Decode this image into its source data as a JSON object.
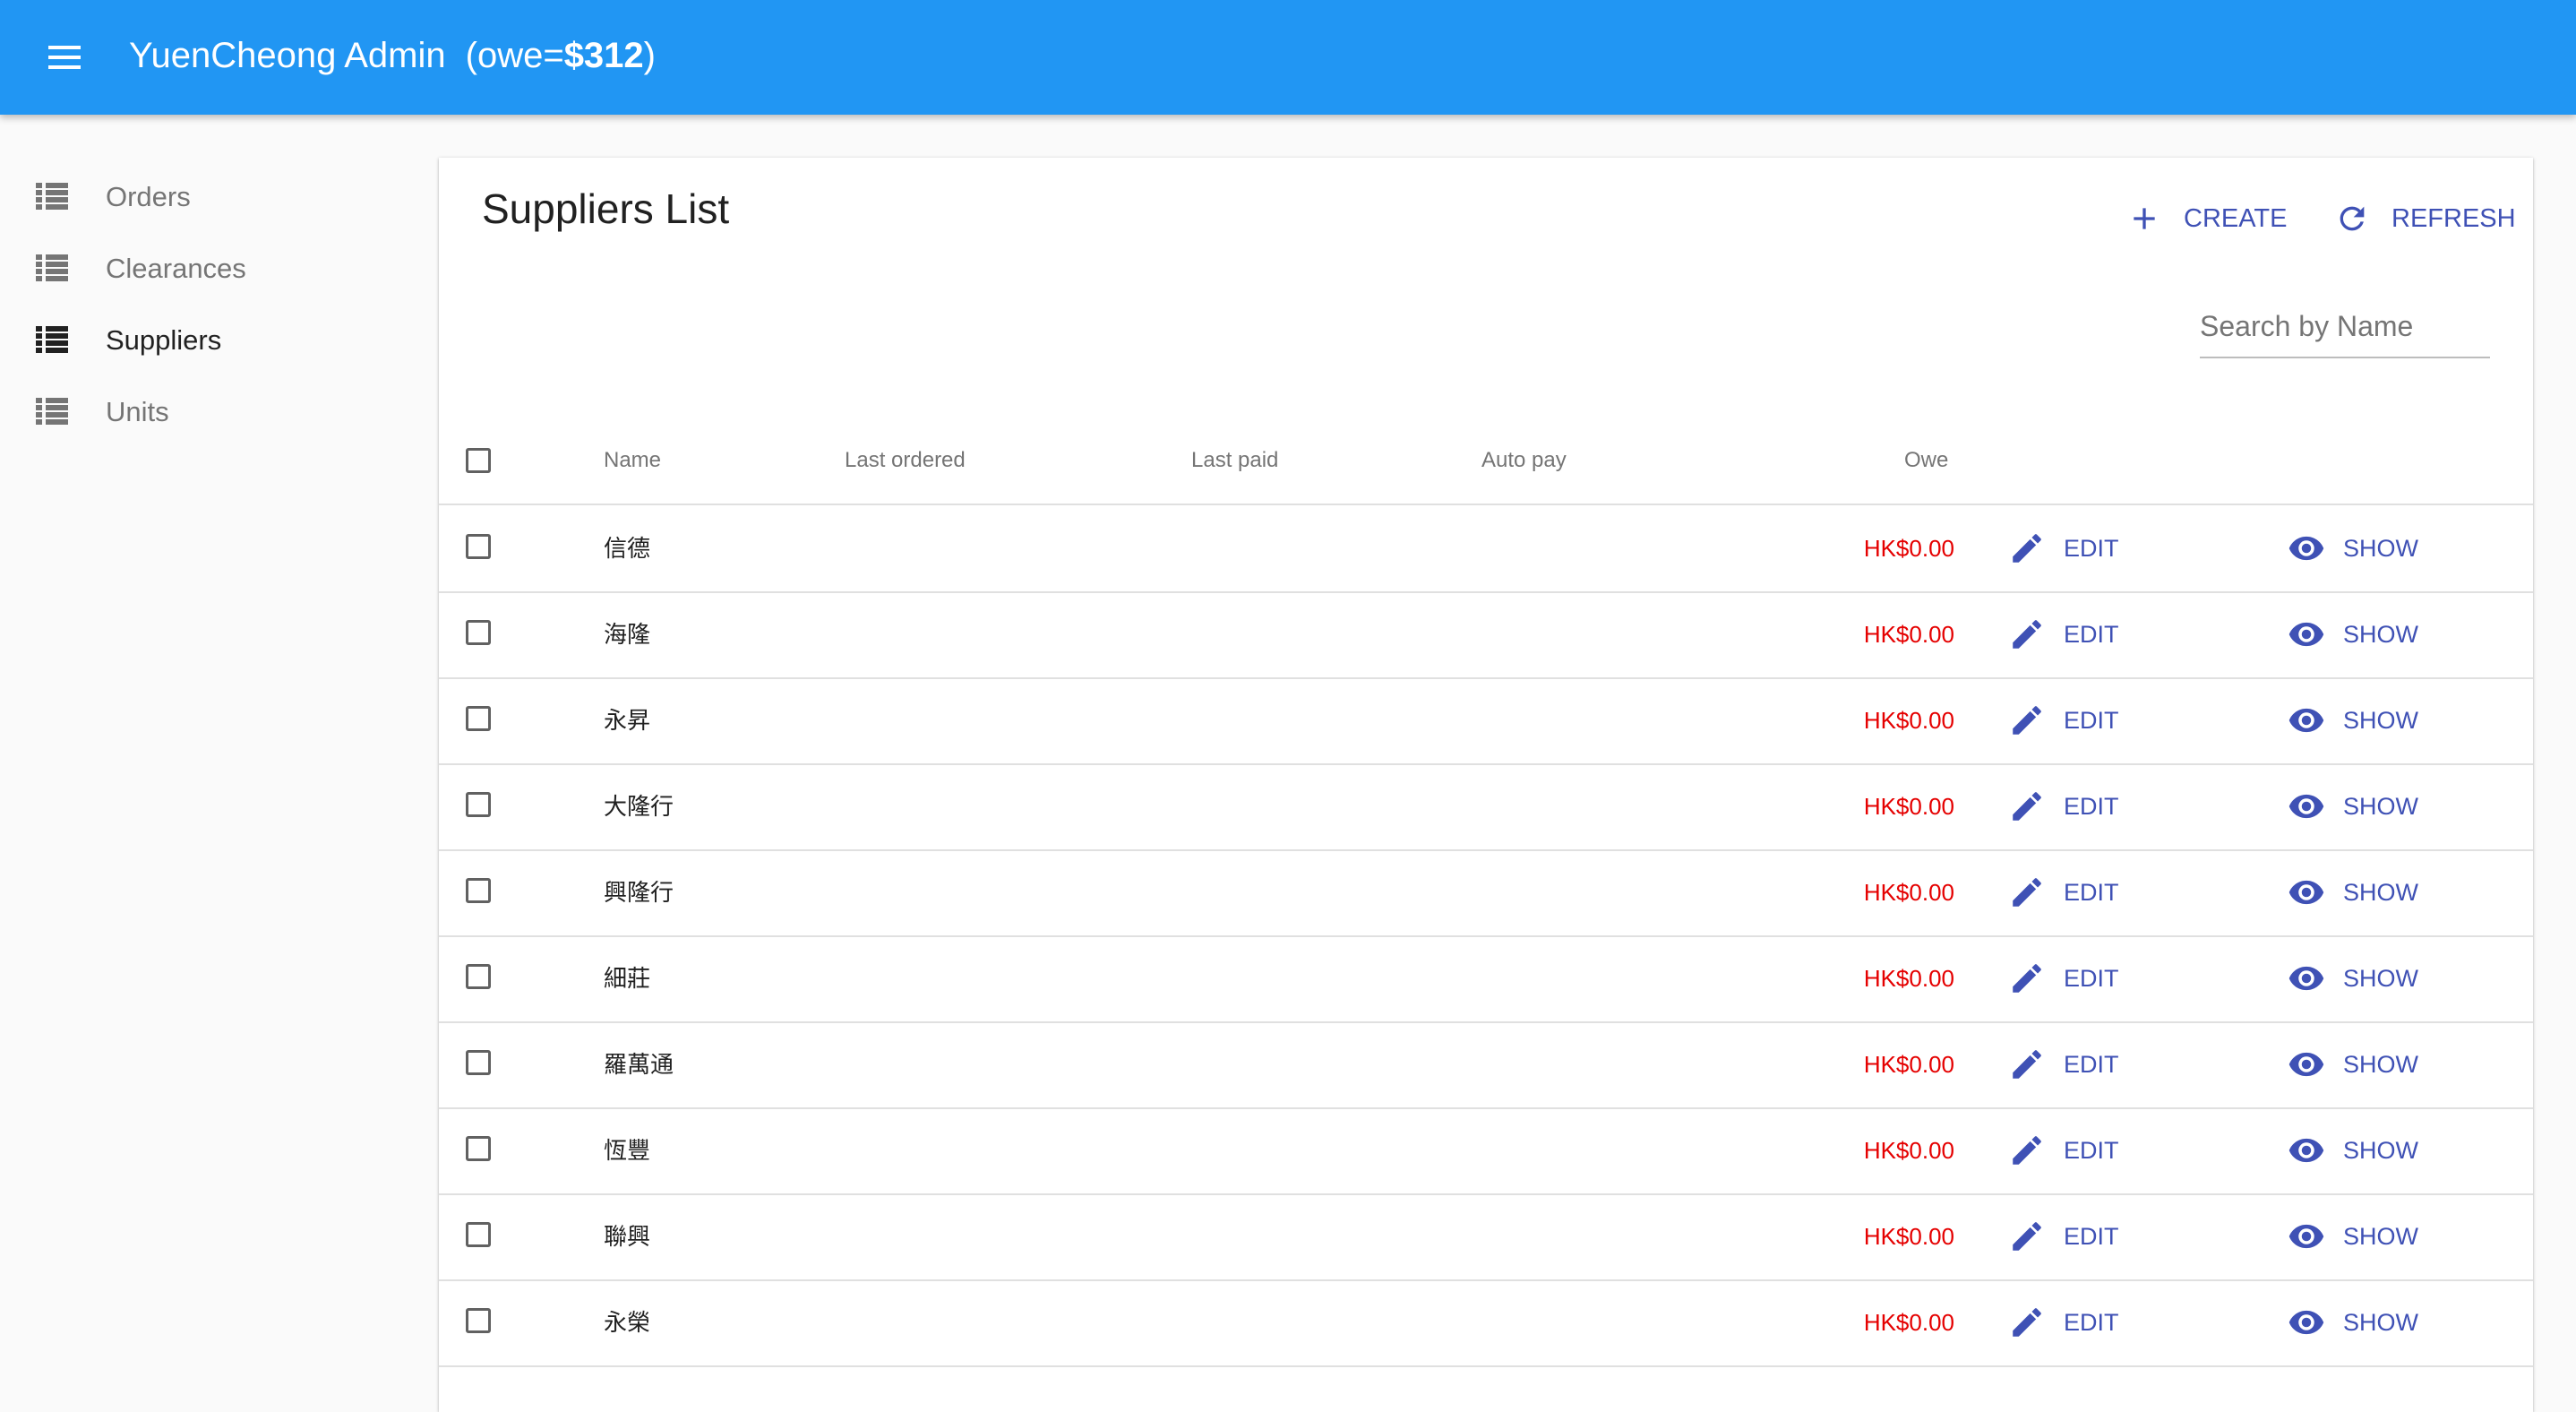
{
  "app": {
    "title": "YuenCheong Admin",
    "owe_prefix": "(owe=",
    "owe_amount": "$312",
    "owe_suffix": ")",
    "menu_icon": "hamburger-menu-icon",
    "bar_color": "#2196f3"
  },
  "sidebar": {
    "items": [
      {
        "label": "Orders",
        "icon": "list-icon",
        "active": false
      },
      {
        "label": "Clearances",
        "icon": "list-icon",
        "active": false
      },
      {
        "label": "Suppliers",
        "icon": "list-icon",
        "active": true
      },
      {
        "label": "Units",
        "icon": "list-icon",
        "active": false
      }
    ]
  },
  "page": {
    "title": "Suppliers List",
    "create_label": "CREATE",
    "refresh_label": "REFRESH",
    "search_placeholder": "Search by Name",
    "accent_color": "#3f51b5",
    "owe_color": "#e50000"
  },
  "table": {
    "columns": [
      "Name",
      "Last ordered",
      "Last paid",
      "Auto pay",
      "Owe"
    ],
    "edit_label": "EDIT",
    "show_label": "SHOW",
    "rows": [
      {
        "name": "信德",
        "owe": "HK$0.00"
      },
      {
        "name": "海隆",
        "owe": "HK$0.00"
      },
      {
        "name": "永昇",
        "owe": "HK$0.00"
      },
      {
        "name": "大隆行",
        "owe": "HK$0.00"
      },
      {
        "name": "興隆行",
        "owe": "HK$0.00"
      },
      {
        "name": "細莊",
        "owe": "HK$0.00"
      },
      {
        "name": "羅萬通",
        "owe": "HK$0.00"
      },
      {
        "name": "恆豐",
        "owe": "HK$0.00"
      },
      {
        "name": "聯興",
        "owe": "HK$0.00"
      },
      {
        "name": "永榮",
        "owe": "HK$0.00"
      }
    ]
  }
}
